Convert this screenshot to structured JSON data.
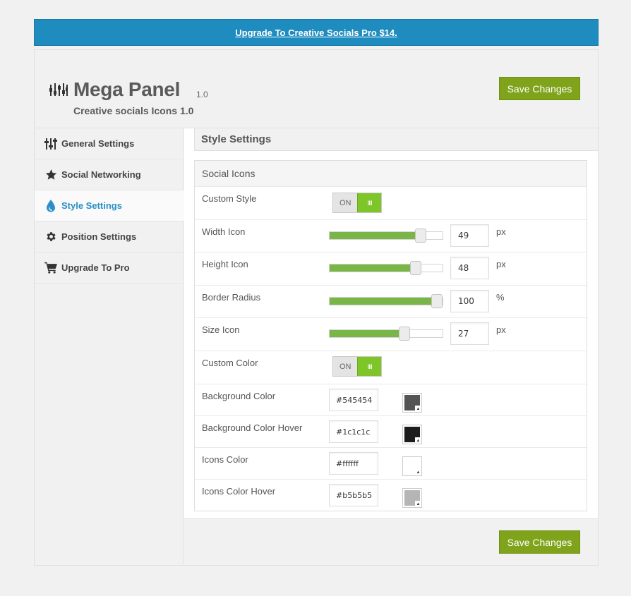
{
  "banner": {
    "text": "Upgrade To Creative Socials Pro $14."
  },
  "header": {
    "title": "Mega Panel",
    "version": "1.0",
    "subtitle": "Creative socials Icons 1.0",
    "save_label": "Save Changes"
  },
  "sidebar": {
    "items": [
      {
        "label": "General Settings",
        "icon": "sliders-icon"
      },
      {
        "label": "Social Networking",
        "icon": "star-icon"
      },
      {
        "label": "Style Settings",
        "icon": "drop-icon",
        "active": true
      },
      {
        "label": "Position Settings",
        "icon": "gear-icon"
      },
      {
        "label": "Upgrade To Pro",
        "icon": "cart-icon"
      }
    ]
  },
  "main": {
    "section_title": "Style Settings",
    "box_title": "Social Icons",
    "custom_style": {
      "label": "Custom Style",
      "off": "ON",
      "on": "IIII",
      "state": "on"
    },
    "width_icon": {
      "label": "Width Icon",
      "value": "49",
      "unit": "px",
      "fraction": 0.84
    },
    "height_icon": {
      "label": "Height Icon",
      "value": "48",
      "unit": "px",
      "fraction": 0.79
    },
    "border_radius": {
      "label": "Border Radius",
      "value": "100",
      "unit": "%",
      "fraction": 1.0
    },
    "size_icon": {
      "label": "Size Icon",
      "value": "27",
      "unit": "px",
      "fraction": 0.68
    },
    "custom_color": {
      "label": "Custom Color",
      "off": "ON",
      "on": "IIII",
      "state": "on"
    },
    "colors": [
      {
        "label": "Background Color",
        "value": "#545454",
        "swatch": "#545454"
      },
      {
        "label": "Background Color Hover",
        "value": "#1c1c1c",
        "swatch": "#1c1c1c"
      },
      {
        "label": "Icons Color",
        "value": "#ffffff",
        "swatch": "#ffffff"
      },
      {
        "label": "Icons Color Hover",
        "value": "#b5b5b5",
        "swatch": "#b5b5b5"
      }
    ],
    "save_label": "Save Changes"
  },
  "theme": {
    "accent": "#2a8fc6",
    "banner": "#1e8cbe",
    "button": "#7fa31a",
    "slider": "#7ab547",
    "toggle": "#7ec628"
  }
}
